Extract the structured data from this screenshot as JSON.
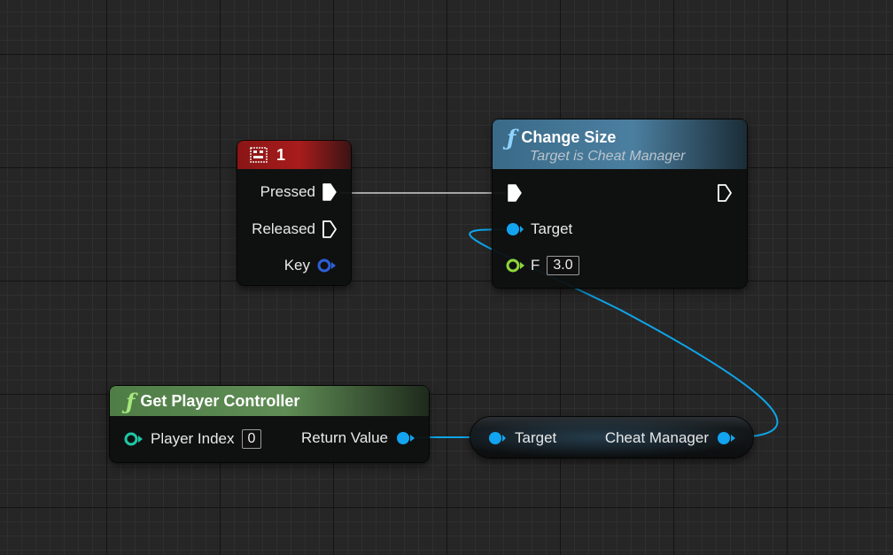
{
  "colors": {
    "exec_wire": "#cfcfcf",
    "object_wire": "#0ea5e9",
    "object_pin": "#12a4f0",
    "key_pin": "#2d5fd8",
    "float_pin": "#8fd63b",
    "int_pin": "#1ec7a5",
    "input_event_header": "#8a1515",
    "function_header": "#3a6a88",
    "pure_function_header": "#4f7d46"
  },
  "input_key_node": {
    "icon": "keyboard-key-icon",
    "title": "1",
    "pins": {
      "pressed": "Pressed",
      "released": "Released",
      "key": "Key"
    }
  },
  "change_size_node": {
    "icon": "function-icon",
    "title": "Change Size",
    "subtitle": "Target is Cheat Manager",
    "pins": {
      "target": "Target",
      "f": "F"
    },
    "f_value": "3.0"
  },
  "get_player_controller_node": {
    "icon": "function-icon",
    "title": "Get Player Controller",
    "pins": {
      "player_index": "Player Index",
      "return_value": "Return Value"
    },
    "player_index_value": "0"
  },
  "cheat_manager_node": {
    "pins": {
      "target": "Target",
      "cheat_manager": "Cheat Manager"
    }
  }
}
